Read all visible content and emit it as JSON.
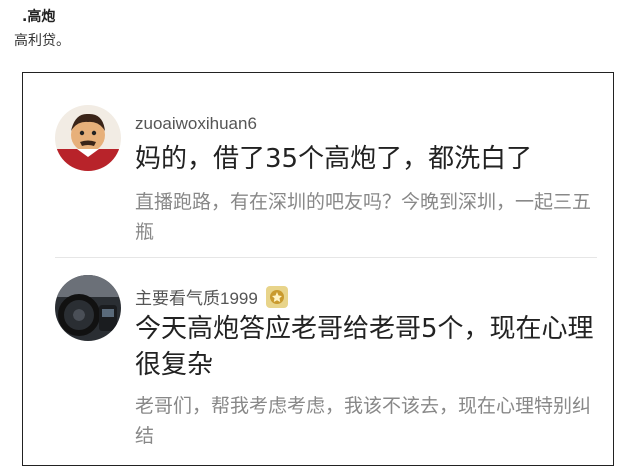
{
  "entry": {
    "title": ".高炮",
    "definition": "高利贷。"
  },
  "posts": [
    {
      "username": "zuoaiwoxihuan6",
      "avatar_icon": "cartoon-character-avatar",
      "main_text": "妈的，借了35个高炮了，都洗白了",
      "sub_text": "直播跑路，有在深圳的吧友吗？今晚到深圳，一起三五瓶"
    },
    {
      "username": "主要看气质1999",
      "avatar_icon": "car-interior-avatar",
      "badge_icon": "medal-badge-icon",
      "main_text": "今天高炮答应老哥给老哥5个，现在心理很复杂",
      "sub_text": "老哥们，帮我考虑考虑，我该不该去，现在心理特别纠结"
    }
  ]
}
